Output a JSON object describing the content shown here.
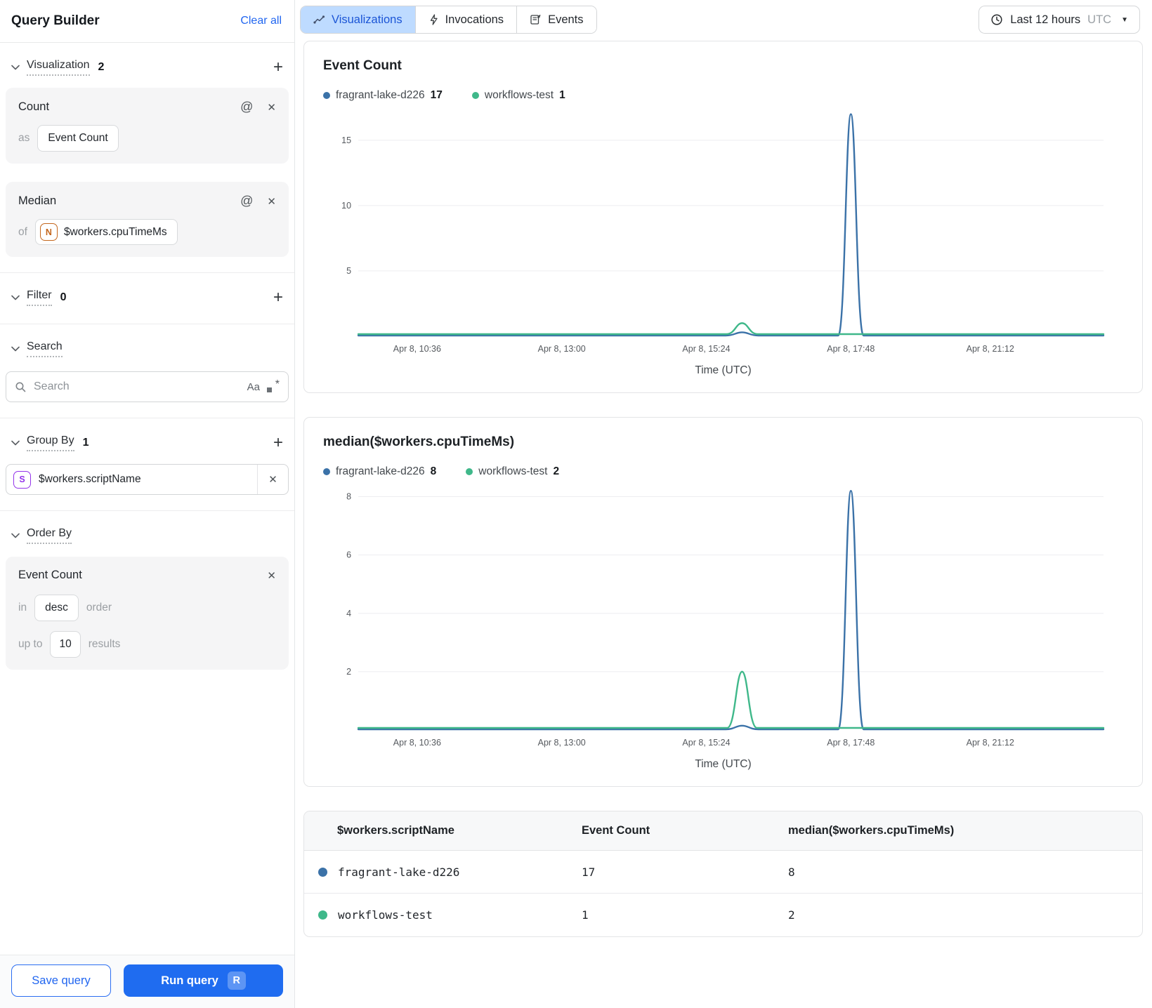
{
  "icons": {
    "plus": "+",
    "close": "✕",
    "at": "@",
    "caret_down": "▼",
    "asterisk": "*"
  },
  "sidebar": {
    "title": "Query Builder",
    "clear_all": "Clear all",
    "visualization": {
      "label": "Visualization",
      "count": "2",
      "cards": [
        {
          "title": "Count",
          "prefix": "as",
          "value": "Event Count"
        },
        {
          "title": "Median",
          "prefix": "of",
          "badge": "N",
          "value": "$workers.cpuTimeMs"
        }
      ]
    },
    "filter": {
      "label": "Filter",
      "count": "0"
    },
    "search": {
      "label": "Search",
      "placeholder": "Search",
      "case_icon": "Aa"
    },
    "group_by": {
      "label": "Group By",
      "count": "1",
      "chip": {
        "badge": "S",
        "value": "$workers.scriptName"
      }
    },
    "order_by": {
      "label": "Order By",
      "field": "Event Count",
      "in_label": "in",
      "direction": "desc",
      "order_label": "order",
      "up_to_label": "up to",
      "limit": "10",
      "results_label": "results"
    },
    "save_button": "Save query",
    "run_button": "Run query",
    "run_shortcut": "R"
  },
  "tabs": [
    {
      "label": "Visualizations"
    },
    {
      "label": "Invocations"
    },
    {
      "label": "Events"
    }
  ],
  "time_range": {
    "label": "Last 12 hours",
    "timezone": "UTC"
  },
  "chart_data": [
    {
      "type": "line",
      "title": "Event Count",
      "xlabel": "Time (UTC)",
      "legend": [
        {
          "name": "fragrant-lake-d226",
          "value": "17"
        },
        {
          "name": "workflows-test",
          "value": "1"
        }
      ],
      "x_ticks": [
        "Apr 8, 10:36",
        "Apr 8, 13:00",
        "Apr 8, 15:24",
        "Apr 8, 17:48",
        "Apr 8, 21:12"
      ],
      "x_tick_fractions": [
        0.079,
        0.273,
        0.467,
        0.661,
        0.848
      ],
      "y_ticks": [
        5,
        10,
        15
      ],
      "ylim": [
        0,
        17.3
      ],
      "grid": true,
      "legend_position": "top",
      "series": [
        {
          "name": "fragrant-lake-d226",
          "color": "#3b72a8",
          "lift": 0,
          "peaks": [
            {
              "x": 0.515,
              "height": 0.3,
              "width": 0.022
            },
            {
              "x": 0.661,
              "height": 17,
              "width": 0.017
            }
          ]
        },
        {
          "name": "workflows-test",
          "color": "#3fb88a",
          "lift": 2,
          "peaks": [
            {
              "x": 0.515,
              "height": 1,
              "width": 0.021
            }
          ]
        }
      ]
    },
    {
      "type": "line",
      "title": "median($workers.cpuTimeMs)",
      "xlabel": "Time (UTC)",
      "legend": [
        {
          "name": "fragrant-lake-d226",
          "value": "8"
        },
        {
          "name": "workflows-test",
          "value": "2"
        }
      ],
      "x_ticks": [
        "Apr 8, 10:36",
        "Apr 8, 13:00",
        "Apr 8, 15:24",
        "Apr 8, 17:48",
        "Apr 8, 21:12"
      ],
      "x_tick_fractions": [
        0.079,
        0.273,
        0.467,
        0.661,
        0.848
      ],
      "y_ticks": [
        2,
        4,
        6,
        8
      ],
      "ylim": [
        0,
        8.35
      ],
      "grid": true,
      "legend_position": "top",
      "series": [
        {
          "name": "fragrant-lake-d226",
          "color": "#3b72a8",
          "lift": 0,
          "peaks": [
            {
              "x": 0.515,
              "height": 0.15,
              "width": 0.022
            },
            {
              "x": 0.661,
              "height": 8.2,
              "width": 0.017
            }
          ]
        },
        {
          "name": "workflows-test",
          "color": "#3fb88a",
          "lift": 2,
          "peaks": [
            {
              "x": 0.515,
              "height": 2,
              "width": 0.02
            }
          ]
        }
      ]
    }
  ],
  "table": {
    "columns": [
      "$workers.scriptName",
      "Event Count",
      "median($workers.cpuTimeMs)"
    ],
    "rows": [
      {
        "dot_color": "#3b72a8",
        "script_name": "fragrant-lake-d226",
        "event_count": "17",
        "median_cpu": "8"
      },
      {
        "dot_color": "#3fb88a",
        "script_name": "workflows-test",
        "event_count": "1",
        "median_cpu": "2"
      }
    ]
  }
}
